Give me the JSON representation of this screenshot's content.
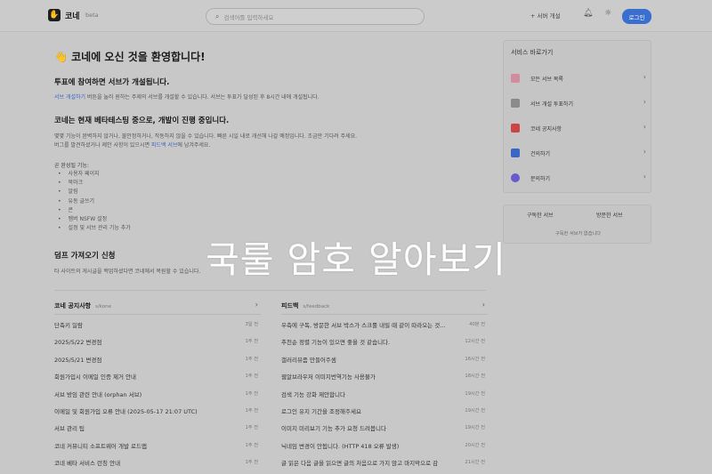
{
  "header": {
    "logo_glyph": "✋",
    "logo_text": "코네",
    "beta": "beta",
    "search_placeholder": "검색어를 입력하세요",
    "search_icon": "search-icon",
    "create_server": "+ 서버 개설",
    "login": "로그인"
  },
  "main": {
    "welcome": "👋 코네에 오신 것을 환영합니다!",
    "vote_title": "투표에 참여하면 서브가 개설됩니다.",
    "vote_desc_link": "서브 개설하기",
    "vote_desc_rest": " 버튼을 눌러 원하는 주제의 서브를 개설할 수 있습니다. 서브는 투표가 달성된 후 8시간 내에 개설됩니다.",
    "beta_title": "코네는 현재 베타테스팅 중으로, 개발이 진행 중입니다.",
    "beta_desc1": "몇몇 기능이 완벽하지 않거나, 불안정하거나, 작동하지 않을 수 있습니다. 빠른 시일 내로 개선해 나갈 예정입니다. 조금만 기다려 주세요.",
    "beta_desc2_a": "버그를 발견하셨거나 제안 사항이 있으시면 ",
    "beta_desc2_link": "피드백 서브",
    "beta_desc2_b": "에 남겨주세요.",
    "features_label": "곧 완성될 기능:",
    "features": [
      "사용자 페이지",
      "북마크",
      "알림",
      "유동 글쓰기",
      "콘",
      "멤버 NSFW 설정",
      "설정 및 서브 관리 기능 추가"
    ],
    "dump_title": "덤프 가져오기 신청",
    "dump_desc": "타 사이트의 게시글을 백업하셨다면 코네에서 복원할 수 있습니다."
  },
  "notice": {
    "title": "코네 공지사항",
    "sub": "s/kone",
    "rows": [
      {
        "title": "단축키 일람",
        "time": "3일 전"
      },
      {
        "title": "2025/5/22 변경점",
        "time": "1주 전"
      },
      {
        "title": "2025/5/21 변경점",
        "time": "1주 전"
      },
      {
        "title": "회원가입시 이메일 인증 제거 안내",
        "time": "1주 전"
      },
      {
        "title": "서브 방임 관련 안내 (orphan 서브)",
        "time": "1주 전"
      },
      {
        "title": "이메일 및 회원가입 오류 안내 (2025-05-17 21:07 UTC)",
        "time": "1주 전"
      },
      {
        "title": "서브 관리 팁",
        "time": "1주 전"
      },
      {
        "title": "코네 커뮤니티 소프트웨어 개발 로드맵",
        "time": "1주 전"
      },
      {
        "title": "코네 베타 서비스 런칭 안내",
        "time": "1주 전"
      }
    ]
  },
  "feedback": {
    "title": "피드백",
    "sub": "s/feedback",
    "rows": [
      {
        "title": "우측에 구독, 방문한 서브 박스가 스크롤 내릴 때 같이 따라오는 것...",
        "time": "40분 전"
      },
      {
        "title": "추천순 정렬 기능이 있으면 좋을 것 같습니다.",
        "time": "12시간 전"
      },
      {
        "title": "갤러리뷰좀 만들어주셈",
        "time": "16시간 전"
      },
      {
        "title": "웹알브라우저 이미지번역기능 사용불가",
        "time": "18시간 전"
      },
      {
        "title": "검색 기능 강화 제안합니다",
        "time": "19시간 전"
      },
      {
        "title": "로그인 유지 기간을 조정해주세요",
        "time": "19시간 전"
      },
      {
        "title": "이미지 미리보기 기능 추가 요청 드려봅니다",
        "time": "19시간 전"
      },
      {
        "title": "닉네임 변경이 안됩니다. (HTTP 418 오류 발생)",
        "time": "20시간 전"
      },
      {
        "title": "글 읽은 다음 글을 읽으면 글의 처음으로 가지 않고 마지막으로 감",
        "time": "21시간 전"
      }
    ]
  },
  "sidebar": {
    "title": "서비스 바로가기",
    "items": [
      {
        "label": "모든 서브 목록",
        "icon": "pages-icon",
        "color": "#d48aa0"
      },
      {
        "label": "서브 개설 투표하기",
        "icon": "building-icon",
        "color": "#8a8a8a"
      },
      {
        "label": "코네 공지사항",
        "icon": "megaphone-icon",
        "color": "#c44"
      },
      {
        "label": "건의하기",
        "icon": "ballot-icon",
        "color": "#3b67c4"
      },
      {
        "label": "문의하기",
        "icon": "question-icon",
        "color": "#6a5acd"
      }
    ],
    "tab_subscribed": "구독한 서브",
    "tab_visited": "방문한 서브",
    "empty": "구독한 서브가 없습니다"
  },
  "overlay": {
    "caption": "국룰 암호 알아보기"
  }
}
